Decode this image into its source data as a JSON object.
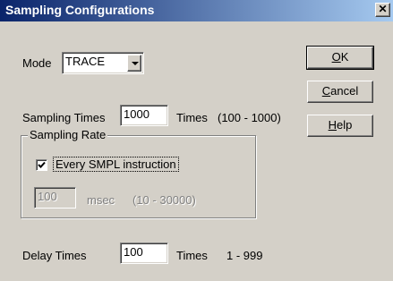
{
  "window": {
    "title": "Sampling Configurations",
    "close_glyph": "✕"
  },
  "mode": {
    "label": "Mode",
    "value": "TRACE"
  },
  "sampling_times": {
    "label": "Sampling Times",
    "value": "1000",
    "unit": "Times",
    "range": "(100 - 1000)"
  },
  "sampling_rate": {
    "group_label": "Sampling Rate",
    "checkbox_label": "Every SMPL instruction",
    "checked": true,
    "interval_value": "100",
    "interval_unit": "msec",
    "interval_range": "(10 - 30000)"
  },
  "delay_times": {
    "label": "Delay Times",
    "value": "100",
    "unit": "Times",
    "range": "1 - 999"
  },
  "buttons": {
    "ok_mnemonic": "O",
    "ok_rest": "K",
    "cancel_mnemonic": "C",
    "cancel_rest": "ancel",
    "help_mnemonic": "H",
    "help_rest": "elp"
  }
}
